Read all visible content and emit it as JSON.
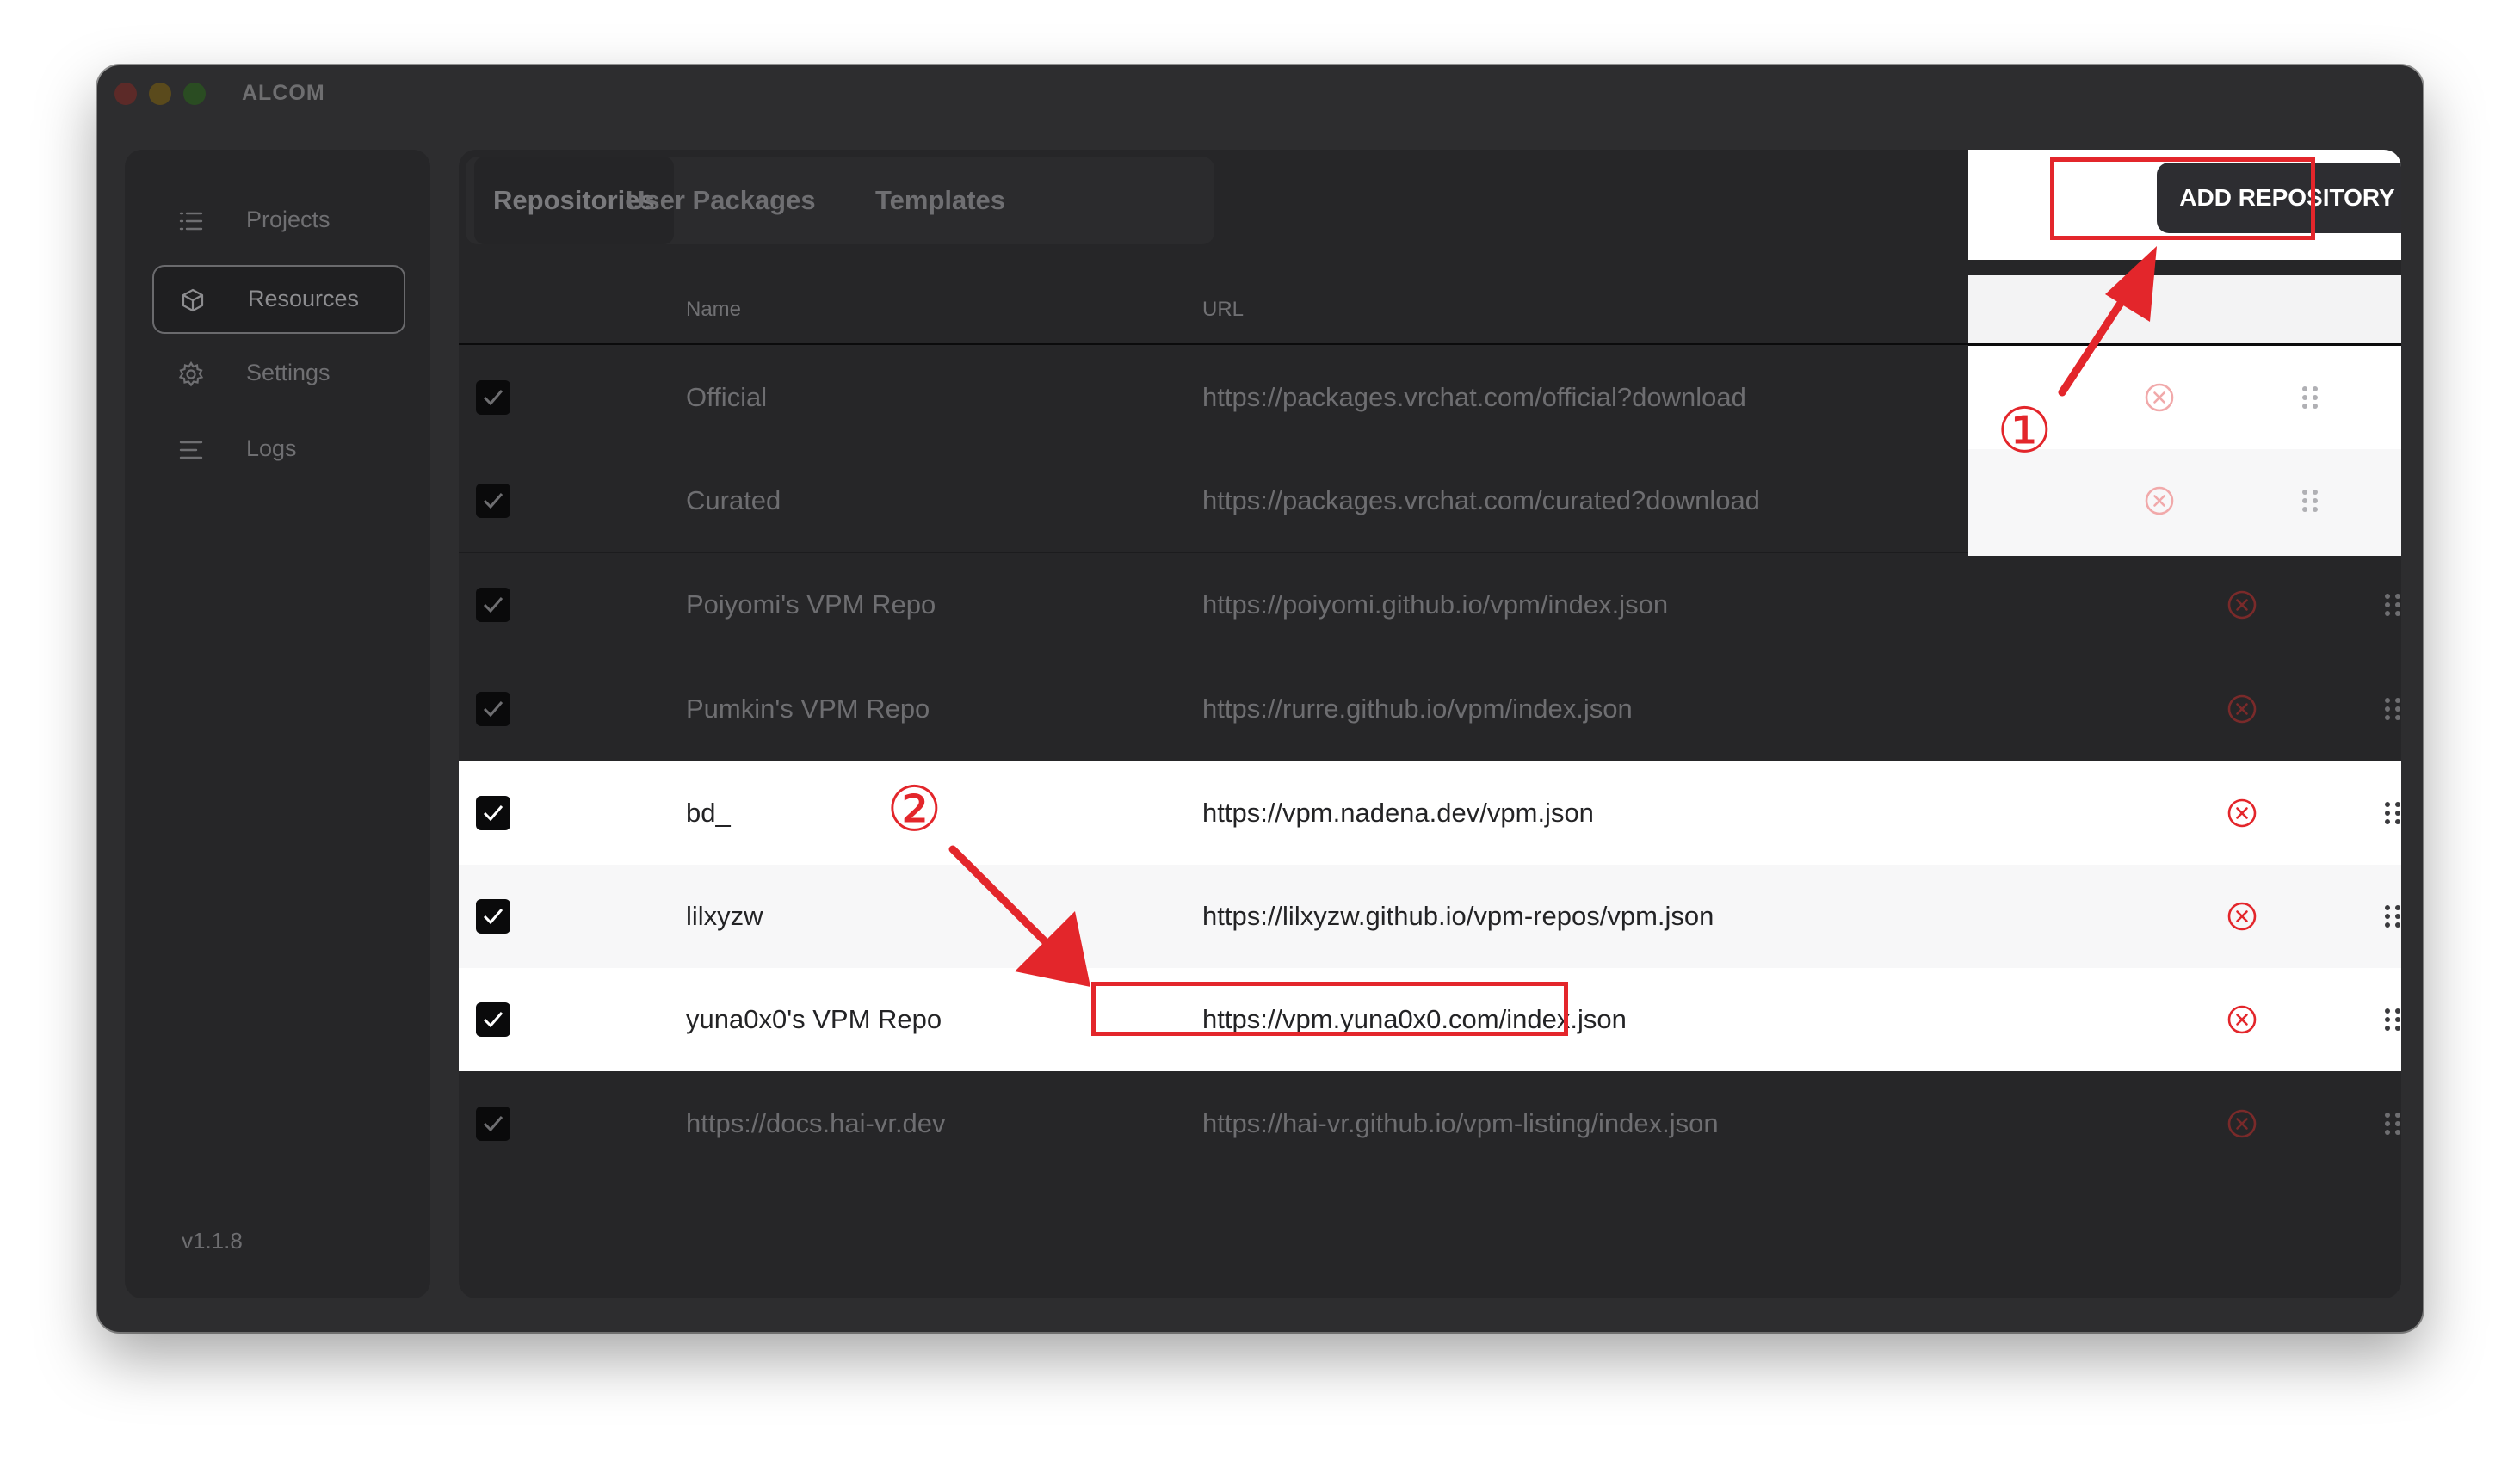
{
  "window": {
    "title": "ALCOM"
  },
  "sidebar": {
    "items": [
      {
        "label": "Projects",
        "icon": "list-icon"
      },
      {
        "label": "Resources",
        "icon": "cube-icon"
      },
      {
        "label": "Settings",
        "icon": "gear-icon"
      },
      {
        "label": "Logs",
        "icon": "logs-icon"
      }
    ],
    "version": "v1.1.8"
  },
  "tabs": [
    {
      "label": "Repositories"
    },
    {
      "label": "User Packages"
    },
    {
      "label": "Templates"
    }
  ],
  "toolbar": {
    "add_label": "ADD REPOSITORY"
  },
  "table": {
    "headers": {
      "name": "Name",
      "url": "URL"
    },
    "rows": [
      {
        "checked": true,
        "name": "Official",
        "url": "https://packages.vrchat.com/official?download"
      },
      {
        "checked": true,
        "name": "Curated",
        "url": "https://packages.vrchat.com/curated?download"
      },
      {
        "checked": true,
        "name": "Poiyomi's VPM Repo",
        "url": "https://poiyomi.github.io/vpm/index.json"
      },
      {
        "checked": true,
        "name": "Pumkin's VPM Repo",
        "url": "https://rurre.github.io/vpm/index.json"
      },
      {
        "checked": true,
        "name": "bd_",
        "url": "https://vpm.nadena.dev/vpm.json"
      },
      {
        "checked": true,
        "name": "lilxyzw",
        "url": "https://lilxyzw.github.io/vpm-repos/vpm.json"
      },
      {
        "checked": true,
        "name": "yuna0x0's VPM Repo",
        "url": "https://vpm.yuna0x0.com/index.json"
      },
      {
        "checked": true,
        "name": "https://docs.hai-vr.dev",
        "url": "https://hai-vr.github.io/vpm-listing/index.json"
      }
    ]
  },
  "annotations": {
    "step1": "①",
    "step2": "②"
  },
  "colors": {
    "annotation": "#e3262b",
    "button": "#2d2d31",
    "window": "#2d2d2f"
  }
}
